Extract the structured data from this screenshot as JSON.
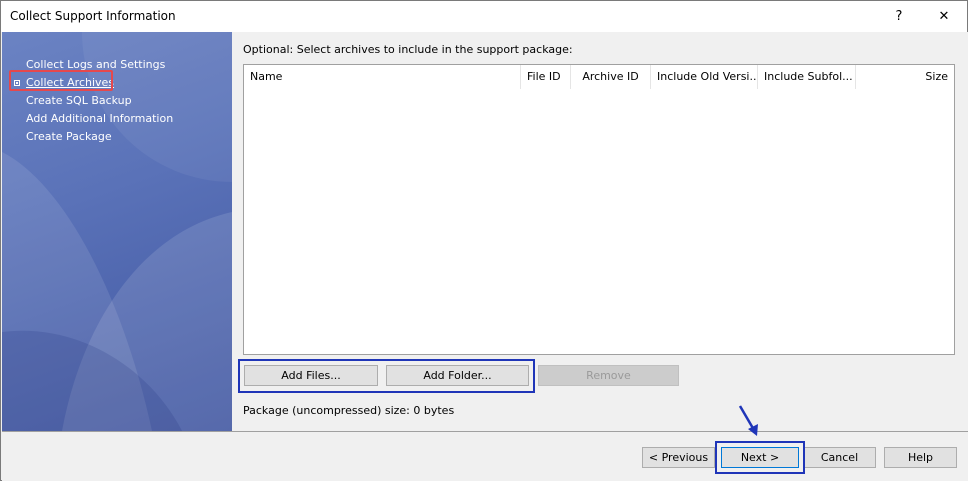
{
  "window": {
    "title": "Collect Support Information",
    "help_glyph": "?",
    "close_glyph": "✕"
  },
  "steps": [
    {
      "label": "Collect Logs and Settings",
      "active": false
    },
    {
      "label": "Collect Archives",
      "active": true
    },
    {
      "label": "Create SQL Backup",
      "active": false
    },
    {
      "label": "Add Additional Information",
      "active": false
    },
    {
      "label": "Create Package",
      "active": false
    }
  ],
  "main": {
    "instruction": "Optional: Select archives to include in the support package:",
    "columns": [
      "Name",
      "File ID",
      "Archive ID",
      "Include Old Versi...",
      "Include Subfol...",
      "Size"
    ],
    "rows": [],
    "add_files_label": "Add Files...",
    "add_folder_label": "Add Folder...",
    "remove_label": "Remove",
    "package_size": "Package (uncompressed) size: 0 bytes"
  },
  "footer": {
    "previous_label": "< Previous",
    "next_label": "Next >",
    "cancel_label": "Cancel",
    "help_label": "Help"
  },
  "colors": {
    "highlight_red": "#e5484d",
    "highlight_blue": "#1f35b8",
    "sidebar_blue": "#5a72b8"
  }
}
